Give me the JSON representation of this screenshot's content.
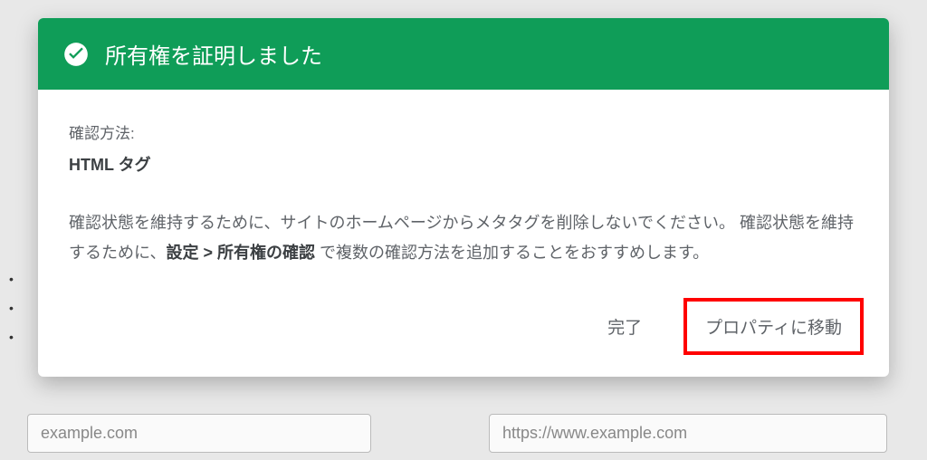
{
  "background": {
    "bullets": [
      "•",
      "•",
      "•"
    ],
    "field_left": "example.com",
    "field_right": "https://www.example.com"
  },
  "dialog": {
    "title": "所有権を証明しました",
    "method_label": "確認方法:",
    "method_value": "HTML タグ",
    "description_pre": "確認状態を維持するために、サイトのホームページからメタタグを削除しないでください。 確認状態を維持するために、",
    "description_bold": "設定 > 所有権の確認",
    "description_post": " で複数の確認方法を追加することをおすすめします。",
    "actions": {
      "done": "完了",
      "goto_property": "プロパティに移動"
    }
  },
  "icons": {
    "check": "check-circle"
  },
  "colors": {
    "header_bg": "#0f9d58",
    "highlight_border": "#ff0000"
  }
}
